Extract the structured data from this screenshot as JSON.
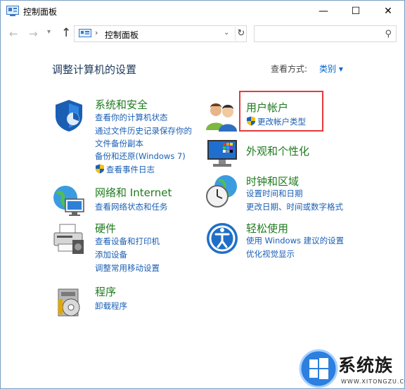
{
  "window": {
    "title": "控制面板",
    "min_glyph": "—",
    "max_glyph": "☐",
    "close_glyph": "✕"
  },
  "nav": {
    "address": "控制面板",
    "search_placeholder": ""
  },
  "content": {
    "heading": "调整计算机的设置",
    "view_by_label": "查看方式:",
    "view_by_value": "类别 ▾"
  },
  "categories": {
    "security": {
      "title": "系统和安全",
      "links": [
        "查看你的计算机状态",
        "通过文件历史记录保存你的",
        "文件备份副本",
        "备份和还原(Windows 7)",
        "查看事件日志"
      ]
    },
    "network": {
      "title": "网络和 Internet",
      "links": [
        "查看网络状态和任务"
      ]
    },
    "hardware": {
      "title": "硬件",
      "links": [
        "查看设备和打印机",
        "添加设备",
        "调整常用移动设置"
      ]
    },
    "programs": {
      "title": "程序",
      "links": [
        "卸载程序"
      ]
    },
    "accounts": {
      "title": "用户帐户",
      "links": [
        "更改帐户类型"
      ]
    },
    "appearance": {
      "title": "外观和个性化",
      "links": []
    },
    "clock": {
      "title": "时钟和区域",
      "links": [
        "设置时间和日期",
        "更改日期、时间或数字格式"
      ]
    },
    "ease": {
      "title": "轻松使用",
      "links": [
        "使用 Windows 建议的设置",
        "优化视觉显示"
      ]
    }
  },
  "watermark": {
    "brand": "系统族",
    "url": "WWW.XITONGZU.COM"
  },
  "colors": {
    "category_title": "#1e7a1e",
    "link": "#1a5fb4",
    "heading": "#1e395b",
    "highlight": "#e33a3a"
  }
}
